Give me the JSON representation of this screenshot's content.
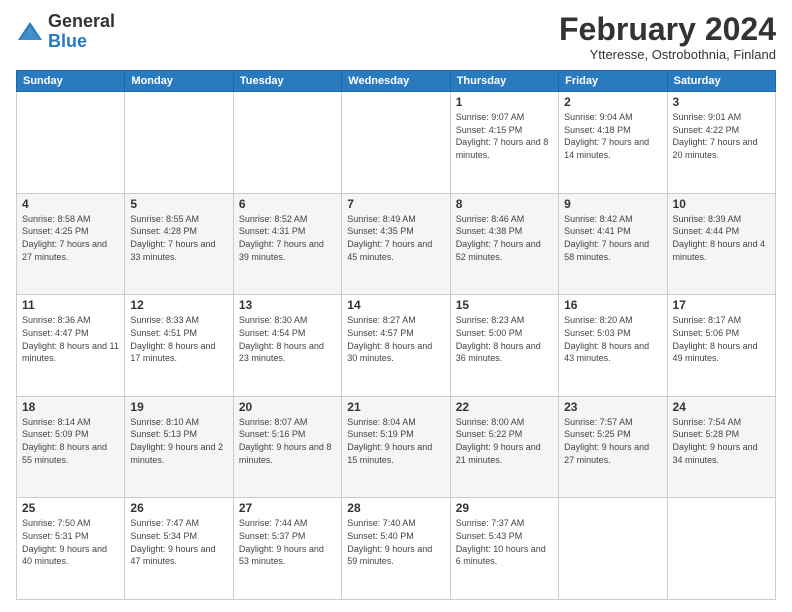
{
  "header": {
    "logo": {
      "general": "General",
      "blue": "Blue"
    },
    "title": "February 2024",
    "location": "Ytteresse, Ostrobothnia, Finland"
  },
  "weekdays": [
    "Sunday",
    "Monday",
    "Tuesday",
    "Wednesday",
    "Thursday",
    "Friday",
    "Saturday"
  ],
  "weeks": [
    [
      null,
      null,
      null,
      null,
      {
        "day": 1,
        "sunrise": "9:07 AM",
        "sunset": "4:15 PM",
        "daylight": "7 hours and 8 minutes."
      },
      {
        "day": 2,
        "sunrise": "9:04 AM",
        "sunset": "4:18 PM",
        "daylight": "7 hours and 14 minutes."
      },
      {
        "day": 3,
        "sunrise": "9:01 AM",
        "sunset": "4:22 PM",
        "daylight": "7 hours and 20 minutes."
      }
    ],
    [
      {
        "day": 4,
        "sunrise": "8:58 AM",
        "sunset": "4:25 PM",
        "daylight": "7 hours and 27 minutes."
      },
      {
        "day": 5,
        "sunrise": "8:55 AM",
        "sunset": "4:28 PM",
        "daylight": "7 hours and 33 minutes."
      },
      {
        "day": 6,
        "sunrise": "8:52 AM",
        "sunset": "4:31 PM",
        "daylight": "7 hours and 39 minutes."
      },
      {
        "day": 7,
        "sunrise": "8:49 AM",
        "sunset": "4:35 PM",
        "daylight": "7 hours and 45 minutes."
      },
      {
        "day": 8,
        "sunrise": "8:46 AM",
        "sunset": "4:38 PM",
        "daylight": "7 hours and 52 minutes."
      },
      {
        "day": 9,
        "sunrise": "8:42 AM",
        "sunset": "4:41 PM",
        "daylight": "7 hours and 58 minutes."
      },
      {
        "day": 10,
        "sunrise": "8:39 AM",
        "sunset": "4:44 PM",
        "daylight": "8 hours and 4 minutes."
      }
    ],
    [
      {
        "day": 11,
        "sunrise": "8:36 AM",
        "sunset": "4:47 PM",
        "daylight": "8 hours and 11 minutes."
      },
      {
        "day": 12,
        "sunrise": "8:33 AM",
        "sunset": "4:51 PM",
        "daylight": "8 hours and 17 minutes."
      },
      {
        "day": 13,
        "sunrise": "8:30 AM",
        "sunset": "4:54 PM",
        "daylight": "8 hours and 23 minutes."
      },
      {
        "day": 14,
        "sunrise": "8:27 AM",
        "sunset": "4:57 PM",
        "daylight": "8 hours and 30 minutes."
      },
      {
        "day": 15,
        "sunrise": "8:23 AM",
        "sunset": "5:00 PM",
        "daylight": "8 hours and 36 minutes."
      },
      {
        "day": 16,
        "sunrise": "8:20 AM",
        "sunset": "5:03 PM",
        "daylight": "8 hours and 43 minutes."
      },
      {
        "day": 17,
        "sunrise": "8:17 AM",
        "sunset": "5:06 PM",
        "daylight": "8 hours and 49 minutes."
      }
    ],
    [
      {
        "day": 18,
        "sunrise": "8:14 AM",
        "sunset": "5:09 PM",
        "daylight": "8 hours and 55 minutes."
      },
      {
        "day": 19,
        "sunrise": "8:10 AM",
        "sunset": "5:13 PM",
        "daylight": "9 hours and 2 minutes."
      },
      {
        "day": 20,
        "sunrise": "8:07 AM",
        "sunset": "5:16 PM",
        "daylight": "9 hours and 8 minutes."
      },
      {
        "day": 21,
        "sunrise": "8:04 AM",
        "sunset": "5:19 PM",
        "daylight": "9 hours and 15 minutes."
      },
      {
        "day": 22,
        "sunrise": "8:00 AM",
        "sunset": "5:22 PM",
        "daylight": "9 hours and 21 minutes."
      },
      {
        "day": 23,
        "sunrise": "7:57 AM",
        "sunset": "5:25 PM",
        "daylight": "9 hours and 27 minutes."
      },
      {
        "day": 24,
        "sunrise": "7:54 AM",
        "sunset": "5:28 PM",
        "daylight": "9 hours and 34 minutes."
      }
    ],
    [
      {
        "day": 25,
        "sunrise": "7:50 AM",
        "sunset": "5:31 PM",
        "daylight": "9 hours and 40 minutes."
      },
      {
        "day": 26,
        "sunrise": "7:47 AM",
        "sunset": "5:34 PM",
        "daylight": "9 hours and 47 minutes."
      },
      {
        "day": 27,
        "sunrise": "7:44 AM",
        "sunset": "5:37 PM",
        "daylight": "9 hours and 53 minutes."
      },
      {
        "day": 28,
        "sunrise": "7:40 AM",
        "sunset": "5:40 PM",
        "daylight": "9 hours and 59 minutes."
      },
      {
        "day": 29,
        "sunrise": "7:37 AM",
        "sunset": "5:43 PM",
        "daylight": "10 hours and 6 minutes."
      },
      null,
      null
    ]
  ],
  "labels": {
    "sunrise": "Sunrise:",
    "sunset": "Sunset:",
    "daylight": "Daylight:"
  }
}
